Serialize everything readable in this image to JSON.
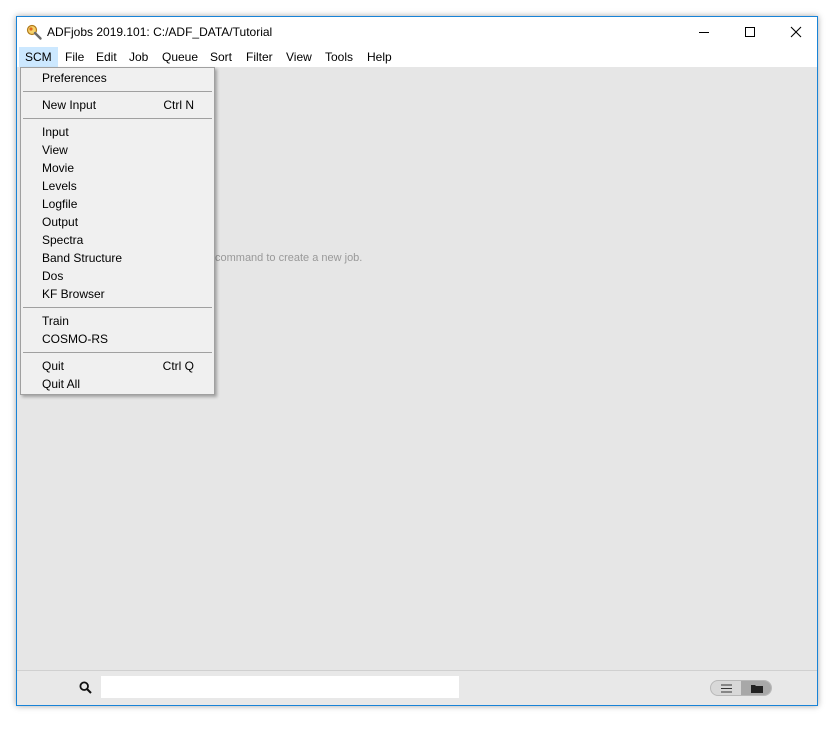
{
  "window": {
    "title": "ADFjobs 2019.101: C:/ADF_DATA/Tutorial",
    "icon": "adf-app-icon",
    "controls": [
      "minimize-icon",
      "maximize-icon",
      "close-icon"
    ]
  },
  "menubar": {
    "items": [
      "SCM",
      "File",
      "Edit",
      "Job",
      "Queue",
      "Sort",
      "Filter",
      "View",
      "Tools",
      "Help"
    ],
    "active": "SCM"
  },
  "dropdown": {
    "groups": [
      [
        {
          "label": "Preferences",
          "shortcut": ""
        }
      ],
      [
        {
          "label": "New Input",
          "shortcut": "Ctrl N"
        }
      ],
      [
        {
          "label": "Input",
          "shortcut": ""
        },
        {
          "label": "View",
          "shortcut": ""
        },
        {
          "label": "Movie",
          "shortcut": ""
        },
        {
          "label": "Levels",
          "shortcut": ""
        },
        {
          "label": "Logfile",
          "shortcut": ""
        },
        {
          "label": "Output",
          "shortcut": ""
        },
        {
          "label": "Spectra",
          "shortcut": ""
        },
        {
          "label": "Band Structure",
          "shortcut": ""
        },
        {
          "label": "Dos",
          "shortcut": ""
        },
        {
          "label": "KF Browser",
          "shortcut": ""
        }
      ],
      [
        {
          "label": "Train",
          "shortcut": ""
        },
        {
          "label": "COSMO-RS",
          "shortcut": ""
        }
      ],
      [
        {
          "label": "Quit",
          "shortcut": "Ctrl Q"
        },
        {
          "label": "Quit All",
          "shortcut": ""
        }
      ]
    ]
  },
  "content": {
    "hint": "command to create a new job."
  },
  "statusbar": {
    "search": {
      "value": "",
      "placeholder": ""
    },
    "view_toggle": {
      "options": [
        "list-view-icon",
        "folder-view-icon"
      ],
      "selected": "folder-view-icon"
    }
  },
  "colors": {
    "accent": "#cce8ff",
    "window_border": "#1883d7",
    "content_bg": "#e6e6e6",
    "menu_bg": "#f0f0f0"
  }
}
